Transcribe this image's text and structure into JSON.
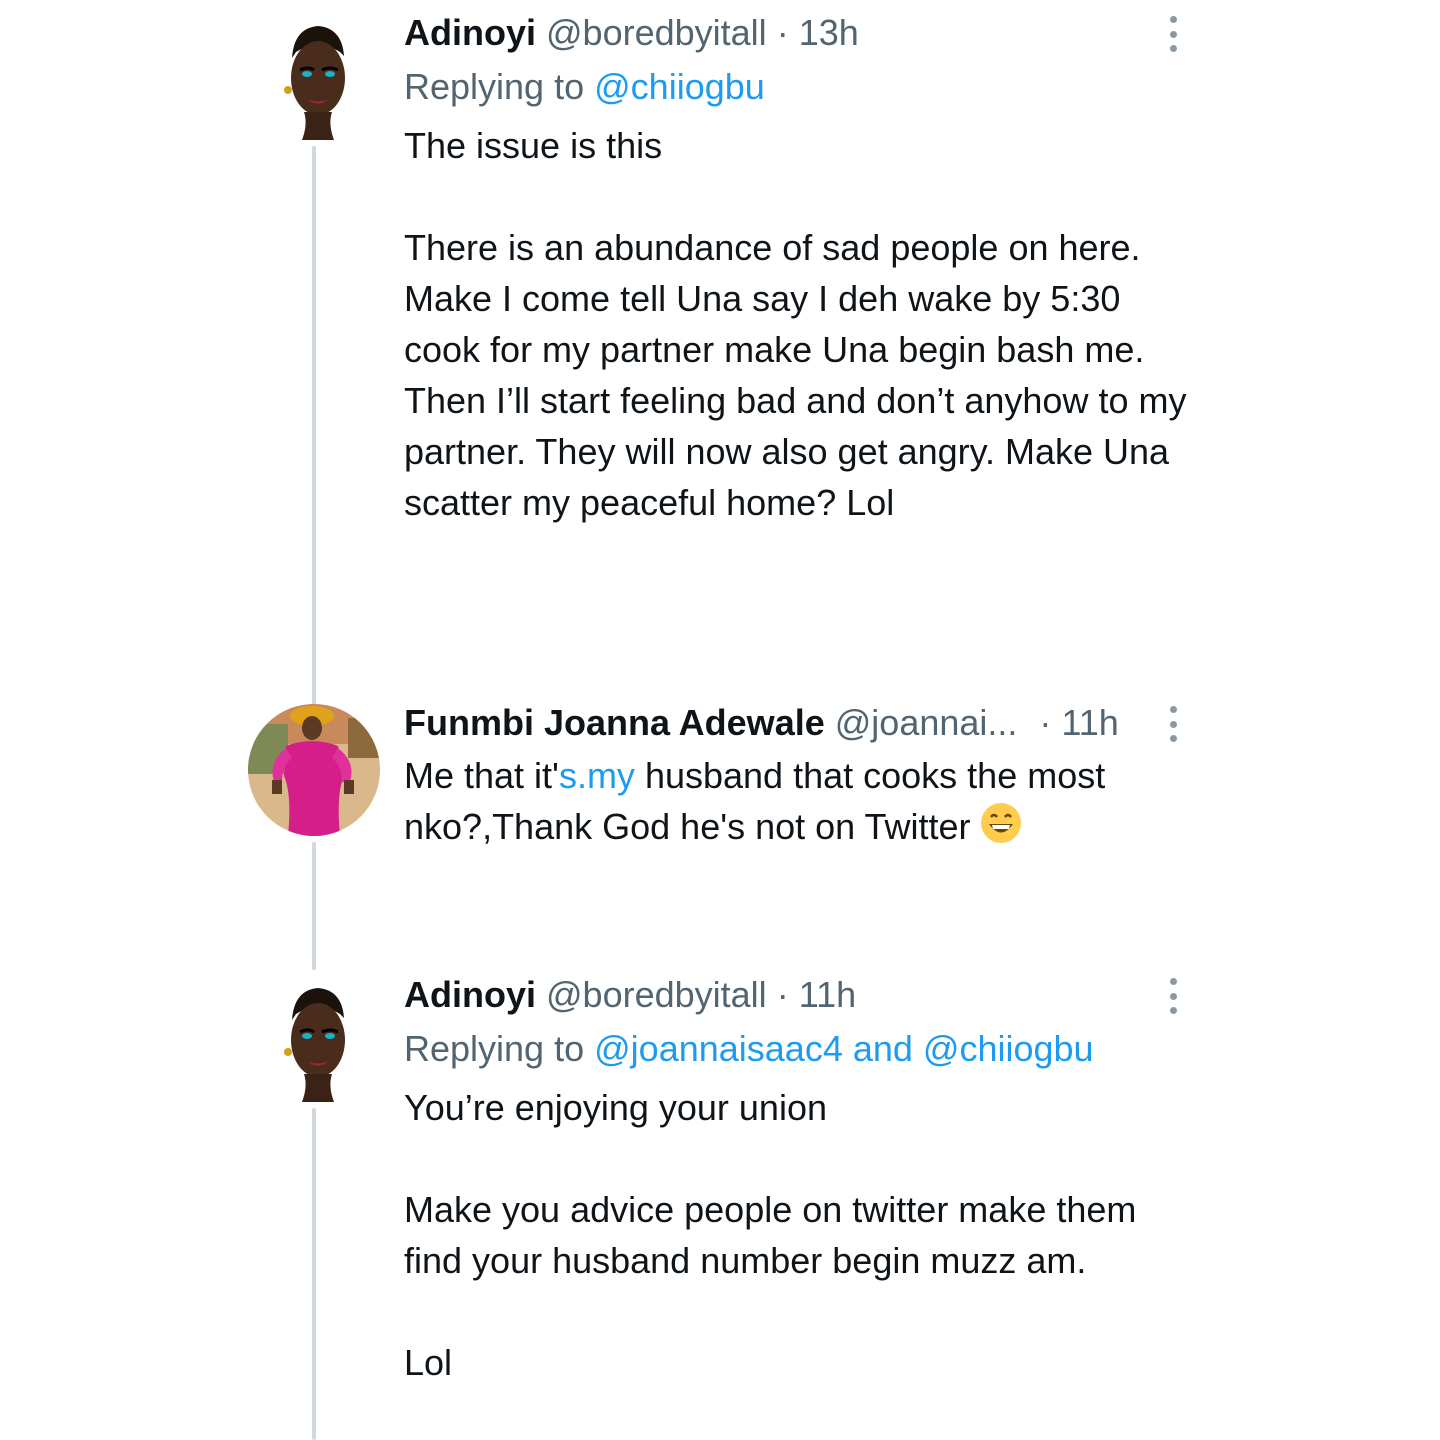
{
  "tweets": [
    {
      "name": "Adinoyi",
      "handle": "@boredbyitall",
      "sep": "·",
      "time": "13h",
      "replying_prefix": "Replying to",
      "replying_to": "@chiiogbu",
      "paragraphs": [
        "The issue is this",
        "There is an abundance of sad people on here. Make I come tell Una say I deh wake by 5:30 cook for my partner make Una begin bash me. Then I’ll start feeling bad and don’t anyhow to my partner. They will now also get angry. Make Una scatter my peaceful home? Lol"
      ]
    },
    {
      "name": "Funmbi Joanna Adewale",
      "handle": "@joannai...",
      "sep": "·",
      "time": "11h",
      "text_before_link": "Me that it'",
      "link_text": "s.my",
      "text_after_link": " husband that cooks the most nko?,Thank God he's not on Twitter",
      "emoji": "grinning-face-emoji"
    },
    {
      "name": "Adinoyi",
      "handle": "@boredbyitall",
      "sep": "·",
      "time": "11h",
      "replying_prefix": "Replying to",
      "replying_to": "@joannaisaac4 and @chiiogbu",
      "paragraphs": [
        "You’re enjoying your union",
        "Make you advice people on twitter make them find your husband number begin muzz am.",
        "Lol"
      ]
    }
  ],
  "icons": {
    "more": "more-vertical-icon"
  },
  "colors": {
    "link": "#1d9bf0",
    "muted": "#536471",
    "thread_line": "#cfd9de",
    "text": "#0f1419"
  }
}
